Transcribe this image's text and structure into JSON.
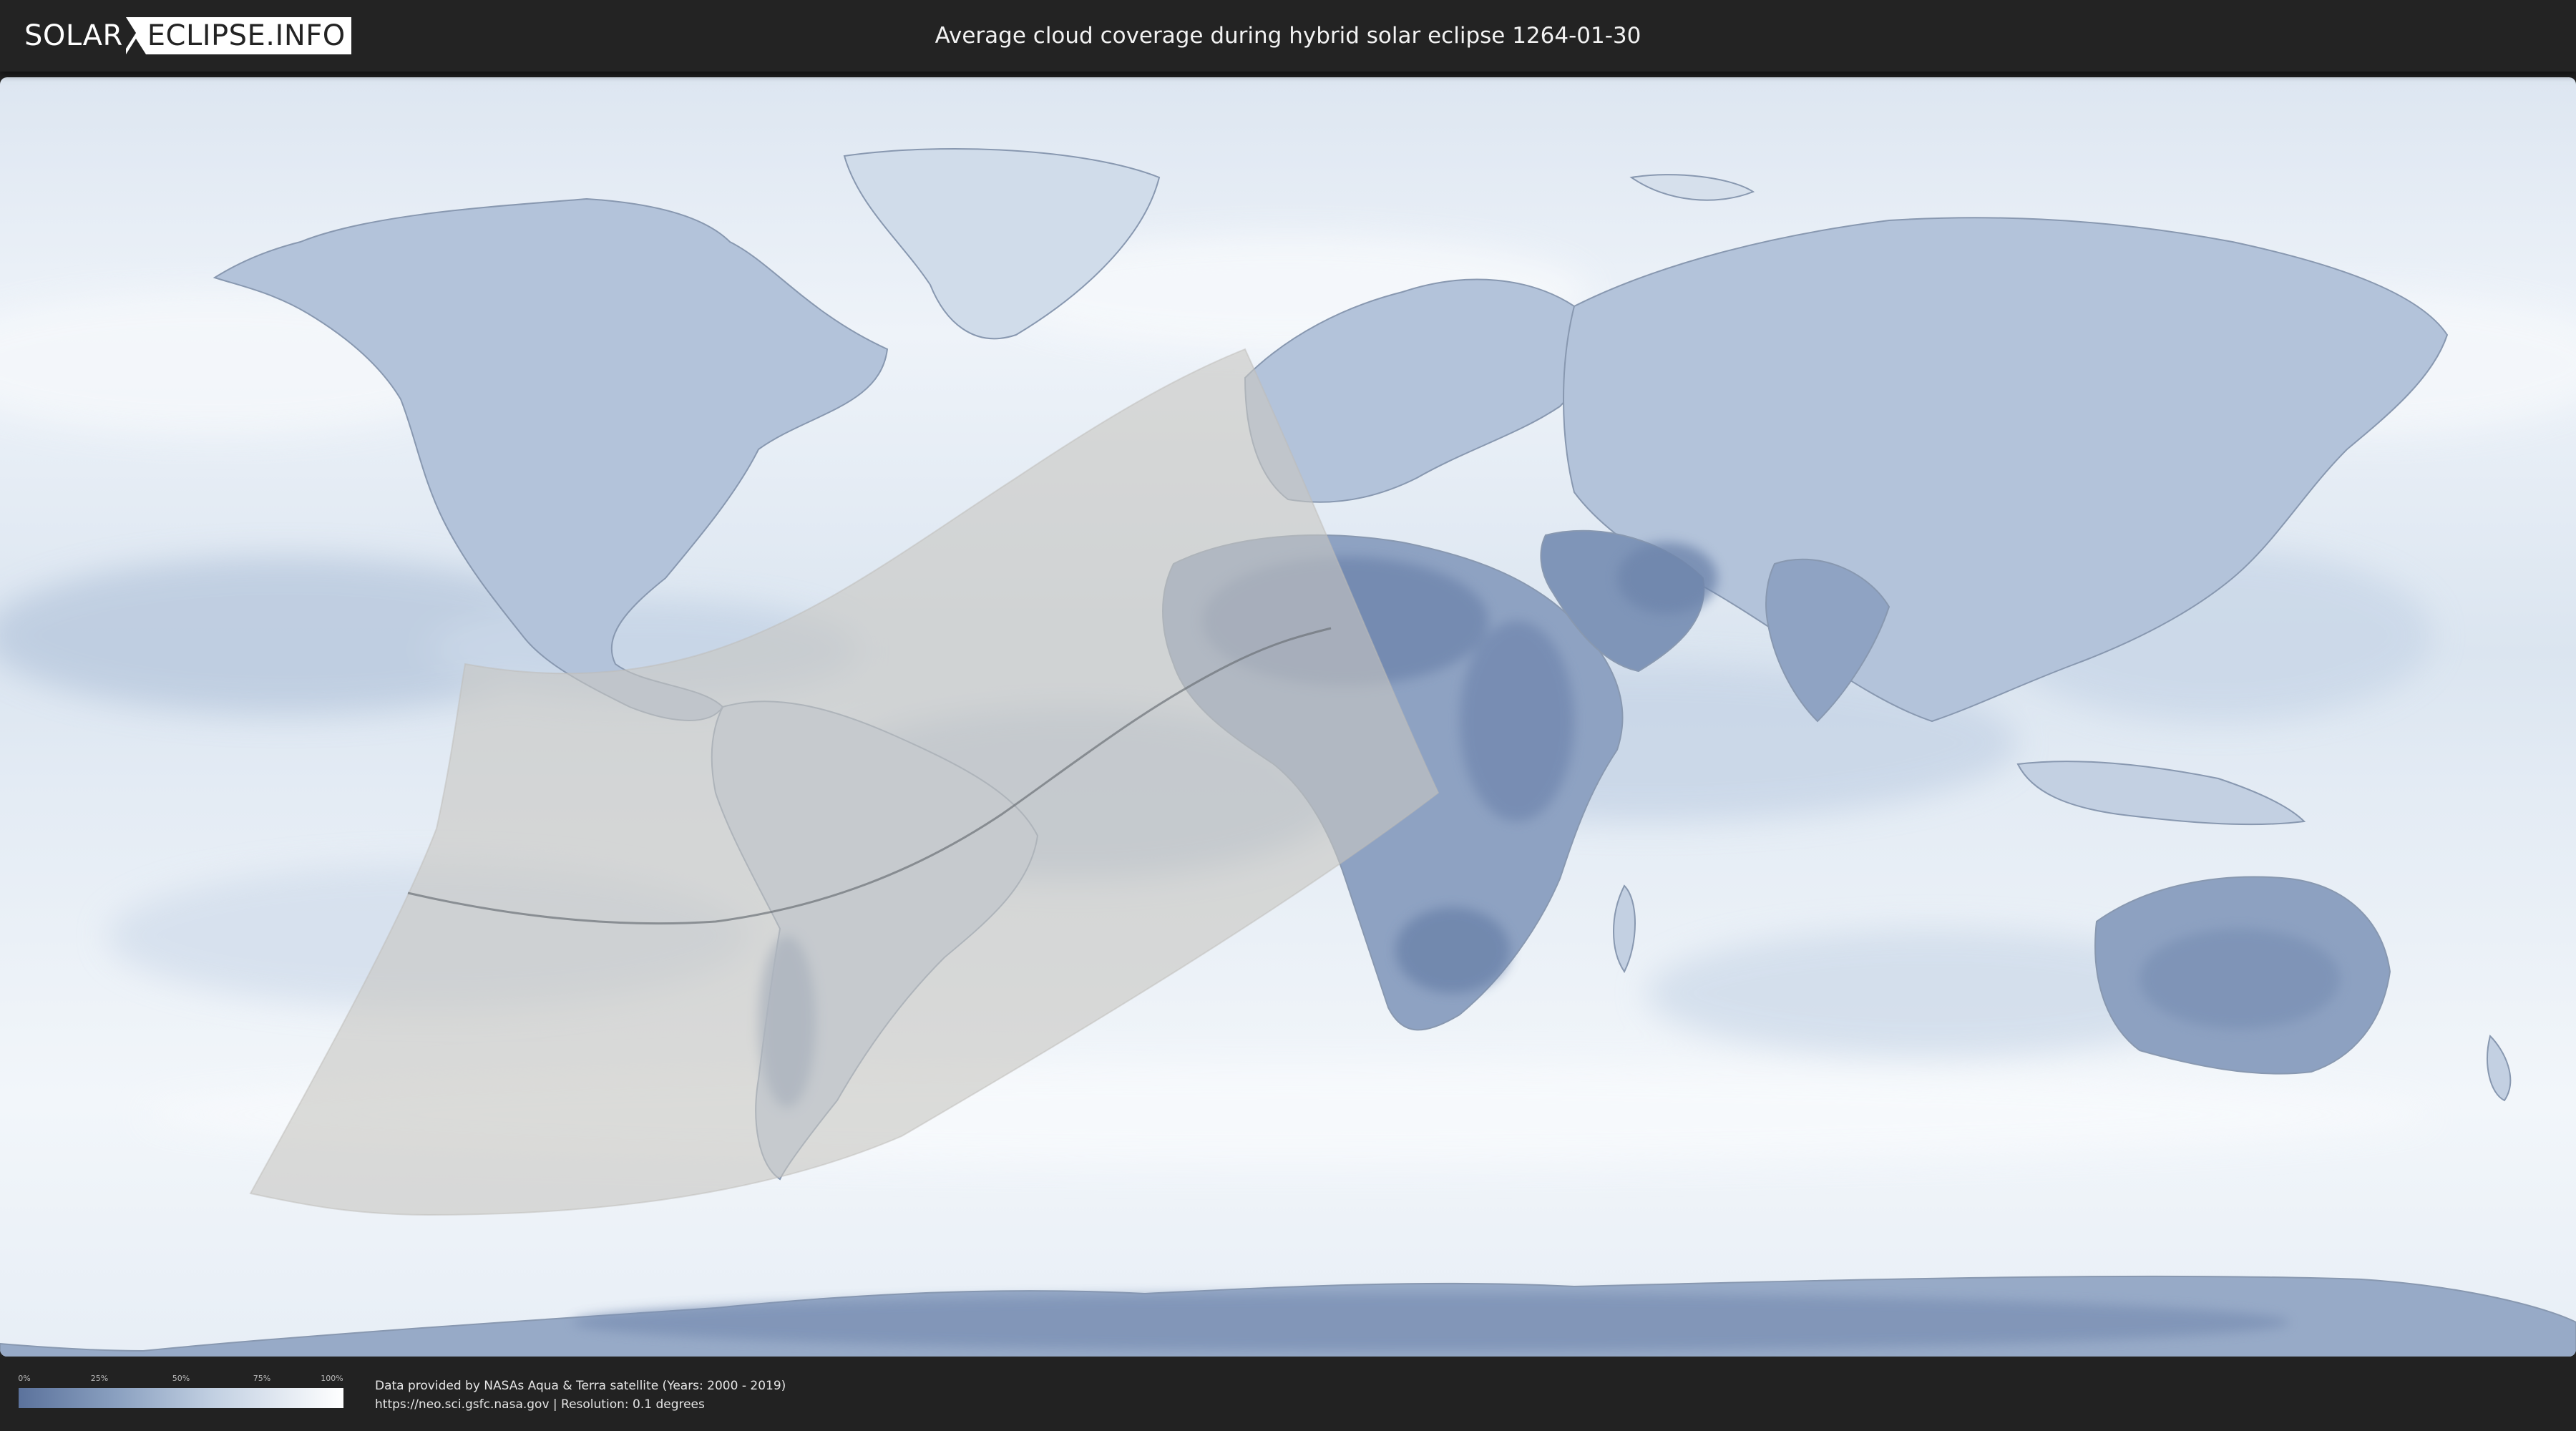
{
  "header": {
    "logo_left": "SOLAR",
    "logo_right": "ECLIPSE.INFO",
    "title": "Average cloud coverage during hybrid solar eclipse 1264-01-30"
  },
  "map": {
    "layer": "average cloud coverage",
    "colors": {
      "ocean_cloud": "#e9f0f7",
      "land_clear": "#6f86ad",
      "ice": "#dfe7f1",
      "eclipse_shadow": "#c8c6c2",
      "center_line": "#6c7278",
      "coastline": "#7f8fa6"
    }
  },
  "legend": {
    "ticks": [
      "0%",
      "25%",
      "50%",
      "75%",
      "100%"
    ],
    "gradient_start": "#5b729c",
    "gradient_end": "#ffffff"
  },
  "credits": {
    "line1": "Data provided by NASAs Aqua & Terra satellite (Years: 2000 - 2019)",
    "line2": "https://neo.sci.gsfc.nasa.gov | Resolution: 0.1 degrees"
  }
}
